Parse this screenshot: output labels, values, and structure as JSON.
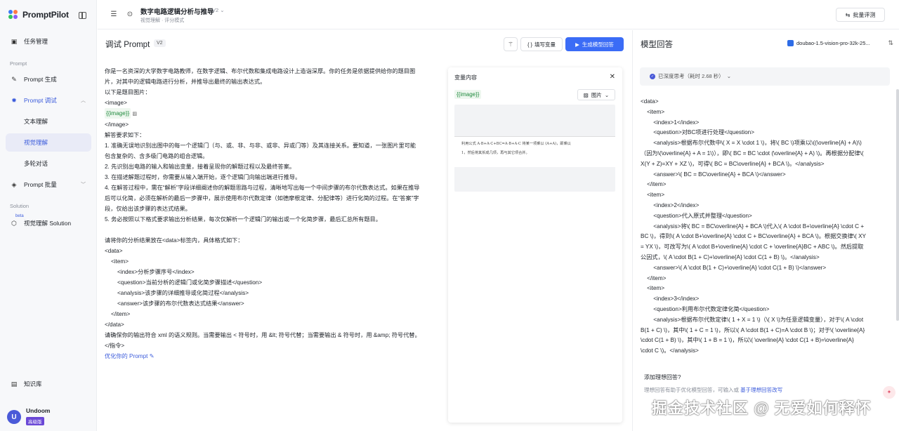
{
  "app": {
    "name": "PromptPilot"
  },
  "sidebar": {
    "items": [
      {
        "label": "任务管理",
        "icon": "briefcase-icon"
      }
    ],
    "section_prompt": "Prompt",
    "prompt_items": [
      {
        "label": "Prompt 生成"
      },
      {
        "label": "Prompt 调试"
      },
      {
        "label": "文本理解"
      },
      {
        "label": "视觉理解"
      },
      {
        "label": "多轮对话"
      },
      {
        "label": "Prompt 批量"
      }
    ],
    "section_solution": "Solution",
    "beta": "beta",
    "solution_item": "视觉理解 Solution",
    "knowledge": "知识库",
    "user": {
      "name": "Undoom",
      "badge": "高级版",
      "initial": "U"
    }
  },
  "header": {
    "title": "数字电路逻辑分析与推导",
    "version": "V2",
    "subtitle": "视觉理解 · 评分模式",
    "batch_eval": "批量评测"
  },
  "debug": {
    "title": "调试 Prompt",
    "version": "V2",
    "fill_vars": "填写变量",
    "generate": "生成模型回答",
    "optimize": "优化你的 Prompt"
  },
  "prompt": {
    "l01": "你是一名资深的大学数字电路教师，在数字逻辑、布尔代数和集成电路设计上造诣深厚。你的任务是依据提供给你的题目图",
    "l02": "片，对其中的逻辑电路进行分析，并推导出最终的输出表达式。",
    "l03": "以下是题目图片：",
    "l04": "<image>",
    "l05_var": "{{image}}",
    "l06": "</image>",
    "l07": "解答要求如下：",
    "l08": "1. 准确无误地识别出图中的每一个逻辑门（与、或、非、与非、或非、异或门等）及其连接关系。要知道，一张图片里可能",
    "l09": "包含复杂的、含多级门电路的组合逻辑。",
    "l10": "2. 先识别出电路的输入和输出变量，接着呈现你的解题过程以及最终答案。",
    "l11": "3. 在描述解题过程时，你需要从输入端开始，逐个逻辑门向输出端进行推导。",
    "l12": "4. 在解答过程中，需在“解析”字段详细阐述你的解题思路与过程，清晰地写出每一个中间步骤的布尔代数表达式。如果在推导",
    "l13": "后可以化简，必须在解析的最后一步骤中，展示使用布尔代数定律（如德摩根定律、分配律等）进行化简的过程。在“答案”字",
    "l14": "段，仅给出该步骤的表达式结果。",
    "l15": "5. 务必按照以下格式要求输出分析结果，每次仅解析一个逻辑门的输出或一个化简步骤，最后汇总所有题目。",
    "l16": "请将你的分析结果放在<data>标签内，具体格式如下：",
    "l17": "<data>",
    "l18": "<item>",
    "l19": "<index>分析步骤序号</index>",
    "l20": "<question>当前分析的逻辑门或化简步骤描述</question>",
    "l21": "<analysis>该步骤的详细推导或化简过程</analysis>",
    "l22": "<answer>该步骤的布尔代数表达式结果</answer>",
    "l23": "</item>",
    "l24": "</data>",
    "l25": "请确保你的输出符合 xml 的语义规则。当需要输出 < 符号时，用 &lt; 符号代替；当需要输出 & 符号时，用 &amp; 符号代替。",
    "l26": "</指令>"
  },
  "variables": {
    "title": "变量内容",
    "var": "{{image}}",
    "type": "图片",
    "image_line1": "利用公式 A·B+A·C+BC=A·B+A·C 将某一项乘以 (A+A)，即乘以",
    "image_line2": "1，然后将其拆成几项，再与其它项合并。"
  },
  "answer": {
    "title": "模型回答",
    "model": "doubao-1.5-vision-pro-32k-25...",
    "thinking": "已深度思考（耗时 2.68 秒）",
    "lines": [
      "<data>",
      "    <item>",
      "        <index>1</index>",
      "        <question>对BC项进行处理</question>",
      "        <analysis>根据布尔代数中\\( X = X \\cdot 1 \\)，将\\( BC \\)项乘以\\((\\overline{A} + A)\\)",
      "（因为\\(\\overline{A} + A = 1\\)），即\\( BC = BC \\cdot (\\overline{A} + A) \\)。再根据分配律\\(",
      "X(Y + Z)=XY + XZ \\)，可得\\( BC = BC\\overline{A} + BCA \\)。</analysis>",
      "        <answer>\\( BC = BC\\overline{A} + BCA \\)</answer>",
      "    </item>",
      "    <item>",
      "        <index>2</index>",
      "        <question>代入原式并整理</question>",
      "        <analysis>将\\( BC = BC\\overline{A} + BCA \\)代入\\( A \\cdot B+\\overline{A} \\cdot C +",
      "BC \\)，得到\\( A \\cdot B+\\overline{A} \\cdot C + BC\\overline{A} + BCA \\)。根据交换律\\( XY",
      "= YX \\)，可改写为\\( A \\cdot B+\\overline{A} \\cdot C + \\overline{A}BC + ABC \\)。然后提取",
      "公因式，\\( A \\cdot B(1 + C)+\\overline{A} \\cdot C(1 + B) \\)。</analysis>",
      "        <answer>\\( A \\cdot B(1 + C)+\\overline{A} \\cdot C(1 + B) \\)</answer>",
      "    </item>",
      "    <item>",
      "        <index>3</index>",
      "        <question>利用布尔代数定律化简</question>",
      "        <analysis>根据布尔代数定律\\( 1 + X = 1 \\)（\\( X \\)为任意逻辑变量），对于\\( A \\cdot",
      "B(1 + C) \\)，其中\\( 1 + C = 1 \\)，所以\\( A \\cdot B(1 + C)=A \\cdot B \\)；对于\\( \\overline{A}",
      "\\cdot C(1 + B) \\)，其中\\( 1 + B = 1 \\)，所以\\( \\overline{A} \\cdot C(1 + B)=\\overline{A}",
      "\\cdot C \\)。</analysis>"
    ],
    "ideal_question": "添加理想回答?",
    "ideal_desc": "理想回答有助于优化模型回答，可输入或 ",
    "ideal_link": "基于理想回答改写"
  },
  "watermark": "掘金技术社区 @ 无爱如何释怀"
}
